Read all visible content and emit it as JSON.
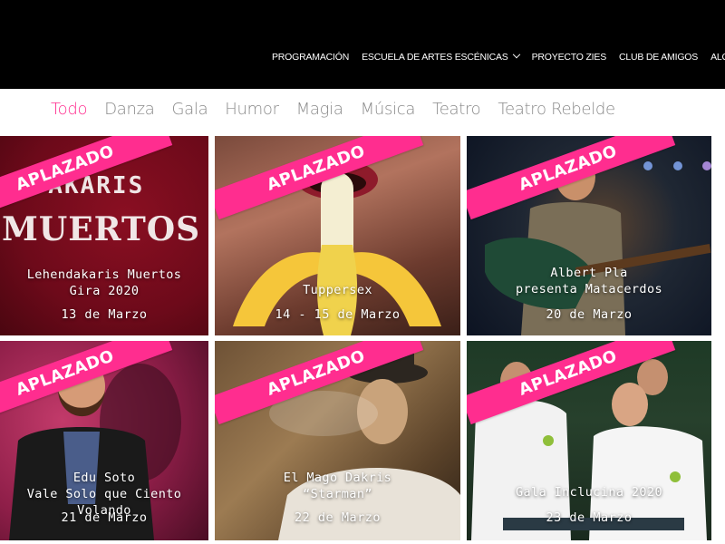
{
  "header": {
    "nav": [
      {
        "label": "PROGRAMACIÓN"
      },
      {
        "label": "ESCUELA DE ARTES ESCÉNICAS",
        "has_dropdown": true
      },
      {
        "label": "PROYECTO ZIES"
      },
      {
        "label": "CLUB DE AMIGOS"
      },
      {
        "label": "ALQ"
      }
    ]
  },
  "filters": {
    "items": [
      "Todo",
      "Danza",
      "Gala",
      "Humor",
      "Magia",
      "Música",
      "Teatro",
      "Teatro Rebelde"
    ],
    "active": "Todo"
  },
  "colors": {
    "accent": "#ff2d8f",
    "header_bg": "#000000",
    "filter_text": "#8a8a8a"
  },
  "events": [
    {
      "badge": "APLAZADO",
      "title": "Lehendakaris Muertos\nGira 2020",
      "date": "13 de Marzo",
      "poster_line1": "NDAKARIS",
      "poster_line2": "MUERTOS"
    },
    {
      "badge": "APLAZADO",
      "title": "Tuppersex",
      "date": "14 - 15 de Marzo"
    },
    {
      "badge": "APLAZADO",
      "title": "Albert Pla\npresenta Matacerdos",
      "date": "20 de Marzo"
    },
    {
      "badge": "APLAZADO",
      "title": "Edu Soto\nVale Solo que Ciento Volando",
      "date": "21 de Marzo"
    },
    {
      "badge": "APLAZADO",
      "title": "El Mago Dakris\n“Starman”",
      "date": "22 de Marzo"
    },
    {
      "badge": "APLAZADO",
      "title": "Gala Inclucina 2020",
      "date": "23 de Marzo"
    }
  ]
}
